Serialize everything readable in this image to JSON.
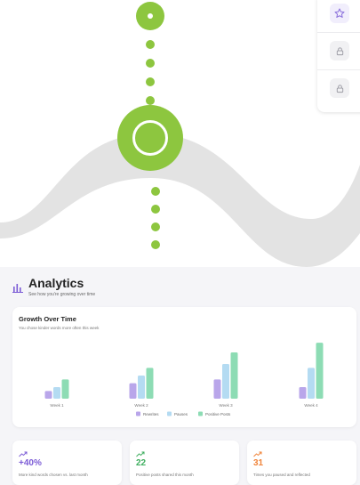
{
  "colors": {
    "journey_green": "#8dc63f",
    "wave_gray": "#e3e3e3",
    "accent_purple": "#7c5cd6",
    "accent_green": "#3fae5f",
    "accent_orange": "#f0843a"
  },
  "analytics": {
    "icon": "bar-chart-icon",
    "title": "Analytics",
    "subtitle": "See how you're growing over time"
  },
  "growth": {
    "title": "Growth Over Time",
    "subtitle": "You chose kinder words more often this week"
  },
  "chart_data": {
    "type": "bar",
    "title": "Growth Over Time",
    "categories": [
      "Week 1",
      "Week 2",
      "Week 3",
      "Week 4"
    ],
    "series": [
      {
        "name": "Rewrites",
        "color": "#b9a6ea",
        "values": [
          2,
          4,
          5,
          3
        ]
      },
      {
        "name": "Pauses",
        "color": "#b4dbf2",
        "values": [
          3,
          6,
          9,
          8
        ]
      },
      {
        "name": "Positive Posts",
        "color": "#8ddcb4",
        "values": [
          5,
          8,
          12,
          14.5
        ]
      }
    ],
    "ylim": [
      0,
      15
    ],
    "grid": false,
    "legend": "bottom-center"
  },
  "stats": [
    {
      "icon": "trending-up-icon",
      "value": "+40%",
      "label": "More kind words chosen vs. last month",
      "color": "#7c5cd6"
    },
    {
      "icon": "trending-up-icon",
      "value": "22",
      "label": "Positive posts shared this month",
      "color": "#3fae5f"
    },
    {
      "icon": "trending-up-icon",
      "value": "31",
      "label": "Times you paused and reflected",
      "color": "#f0843a"
    }
  ],
  "side_panel": {
    "items": [
      {
        "icon": "star-icon"
      },
      {
        "icon": "lock-icon"
      },
      {
        "icon": "lock-icon"
      }
    ]
  }
}
